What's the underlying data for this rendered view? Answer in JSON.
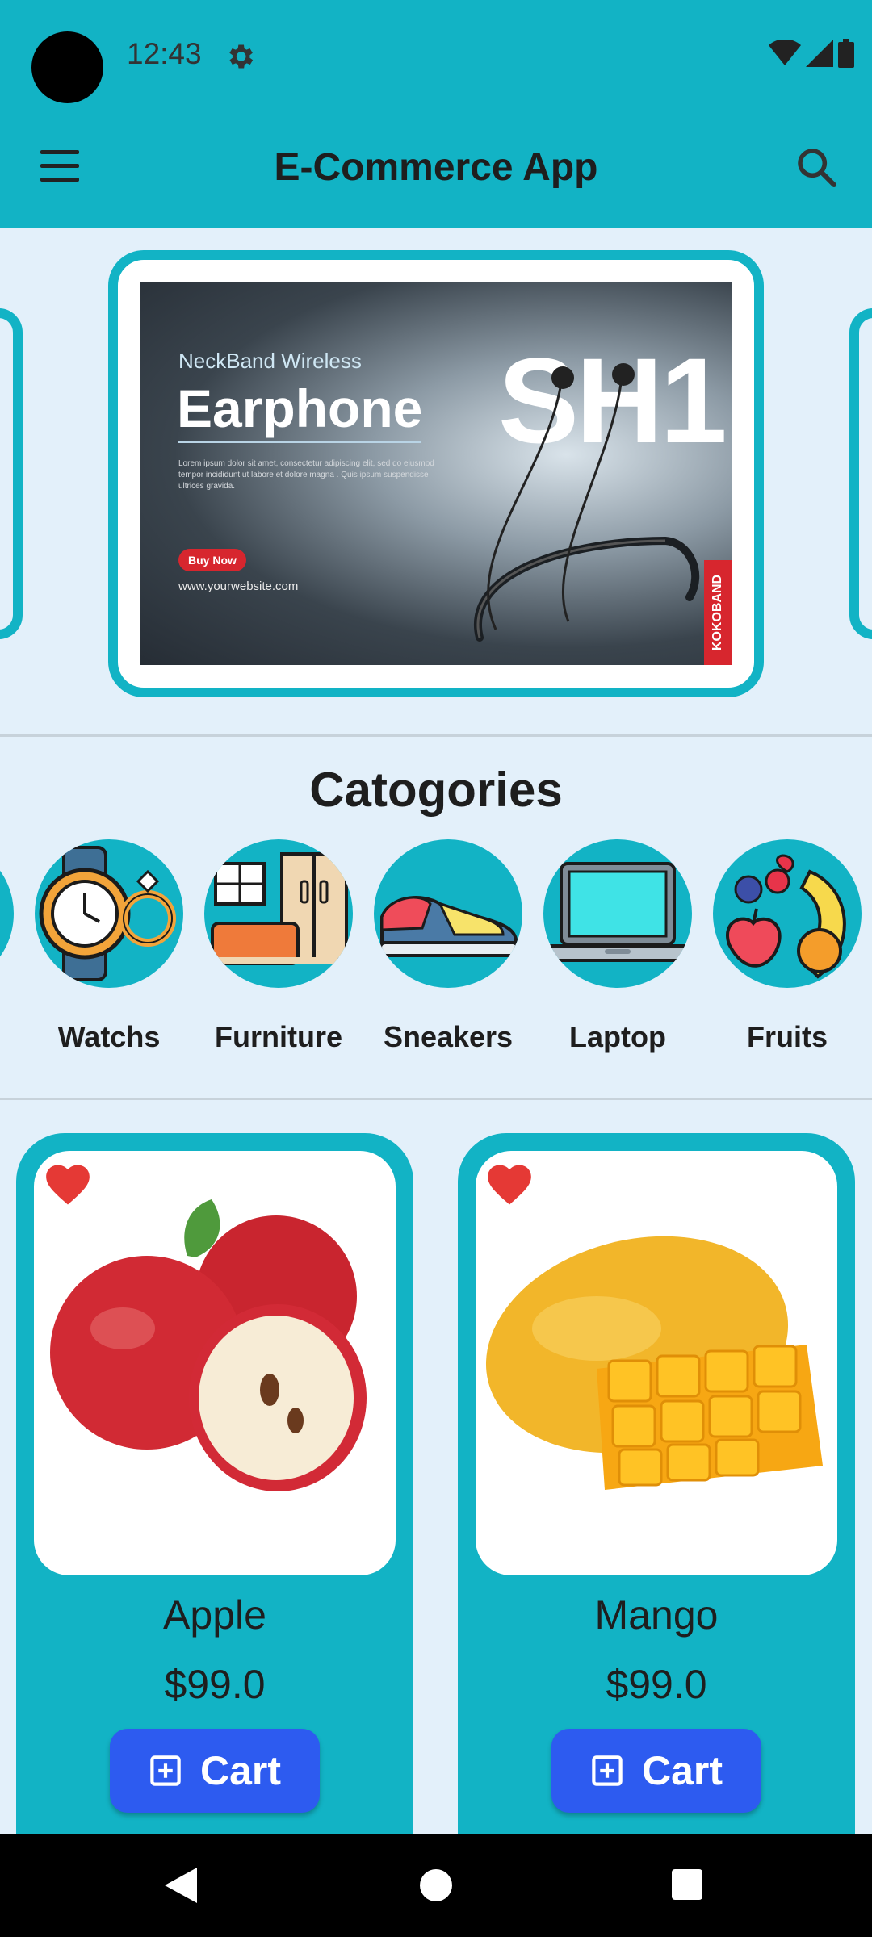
{
  "status_bar": {
    "time": "12:43"
  },
  "app_bar": {
    "title": "E-Commerce App"
  },
  "banner": {
    "subtitle": "NeckBand Wireless",
    "headline": "Earphone",
    "body": "Lorem ipsum dolor sit amet, consectetur adipiscing elit, sed do eiusmod tempor incididunt ut labore et dolore magna . Quis ipsum suspendisse ultrices gravida.",
    "cta": "Buy Now",
    "website": "www.yourwebsite.com",
    "model": "SH1",
    "brand": "KOKOBAND"
  },
  "categories": {
    "title": "Catogories",
    "items": [
      {
        "label": "Watchs",
        "icon": "watch-ring-icon"
      },
      {
        "label": "Furniture",
        "icon": "furniture-icon"
      },
      {
        "label": "Sneakers",
        "icon": "sneaker-icon"
      },
      {
        "label": "Laptop",
        "icon": "laptop-icon"
      },
      {
        "label": "Fruits",
        "icon": "fruits-icon"
      }
    ]
  },
  "products": [
    {
      "name": "Apple",
      "price": "$99.0",
      "cart_label": "Cart",
      "favorite": true
    },
    {
      "name": "Mango",
      "price": "$99.0",
      "cart_label": "Cart",
      "favorite": true
    }
  ],
  "colors": {
    "primary": "#12b3c5",
    "background": "#e3f0fa",
    "cart_button": "#2d5bf0",
    "favorite": "#e53935"
  }
}
